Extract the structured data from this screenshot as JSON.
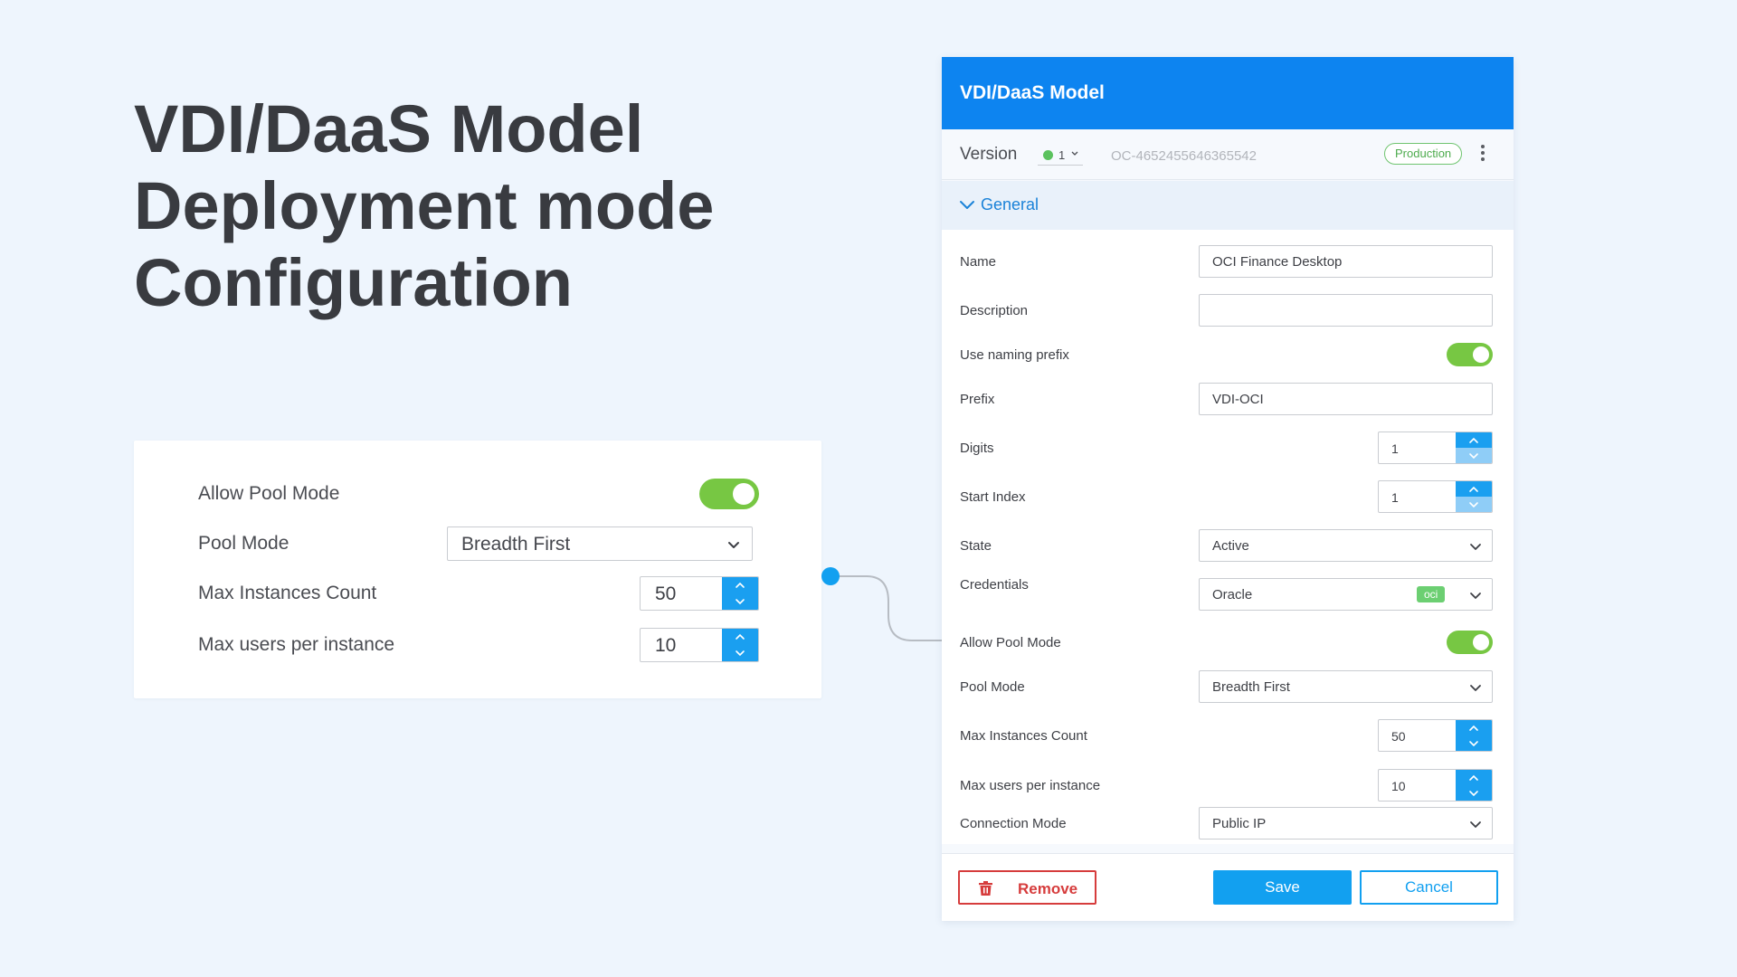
{
  "hero": {
    "line1": "VDI/DaaS Model",
    "line2": "Deployment mode",
    "line3": "Configuration"
  },
  "zoom": {
    "allow_pool_mode_label": "Allow Pool Mode",
    "allow_pool_mode_on": true,
    "pool_mode_label": "Pool Mode",
    "pool_mode_value": "Breadth First",
    "max_instances_label": "Max Instances Count",
    "max_instances_value": "50",
    "max_users_label": "Max users per instance",
    "max_users_value": "10"
  },
  "panel": {
    "title": "VDI/DaaS Model",
    "version": {
      "label": "Version",
      "value": "1",
      "id": "OC-4652455646365542",
      "status": "Production"
    },
    "section": {
      "title": "General"
    },
    "fields": {
      "name": {
        "label": "Name",
        "value": "OCI Finance Desktop"
      },
      "description": {
        "label": "Description",
        "value": ""
      },
      "use_naming_prefix": {
        "label": "Use naming prefix",
        "on": true
      },
      "prefix": {
        "label": "Prefix",
        "value": "VDI-OCI"
      },
      "digits": {
        "label": "Digits",
        "value": "1"
      },
      "start_index": {
        "label": "Start Index",
        "value": "1"
      },
      "state": {
        "label": "State",
        "value": "Active"
      },
      "credentials": {
        "label": "Credentials",
        "value": "Oracle",
        "badge": "oci"
      },
      "allow_pool_mode": {
        "label": "Allow Pool Mode",
        "on": true
      },
      "pool_mode": {
        "label": "Pool Mode",
        "value": "Breadth First"
      },
      "max_instances": {
        "label": "Max Instances Count",
        "value": "50"
      },
      "max_users": {
        "label": "Max users per instance",
        "value": "10"
      },
      "connection_mode": {
        "label": "Connection Mode",
        "value": "Public IP"
      }
    },
    "footer": {
      "remove_label": "Remove",
      "save_label": "Save",
      "cancel_label": "Cancel"
    }
  },
  "colors": {
    "accent": "#0d84f0",
    "toggle_on": "#77c743",
    "danger": "#d63c3c",
    "background": "#eef5fd"
  }
}
